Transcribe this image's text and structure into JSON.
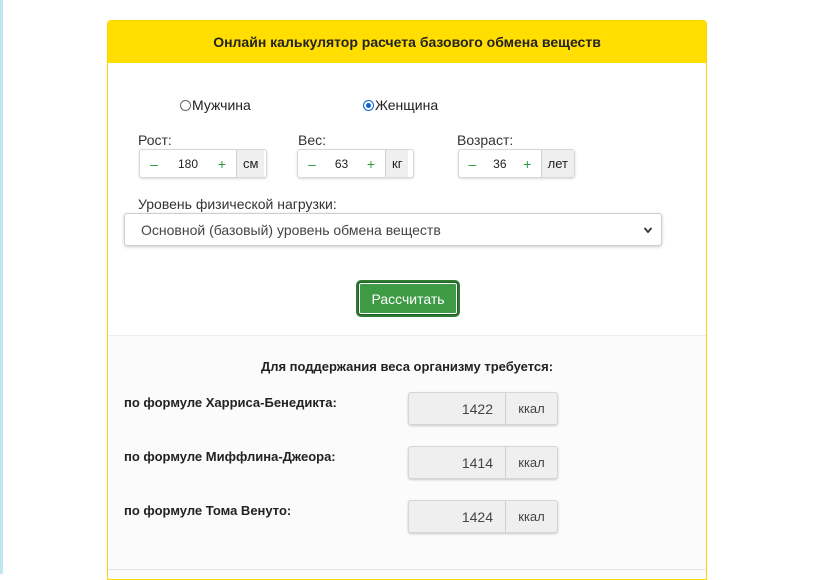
{
  "header": {
    "title": "Онлайн калькулятор расчета базового обмена веществ"
  },
  "gender": {
    "options": [
      {
        "label": "Мужчина",
        "checked": false
      },
      {
        "label": "Женщина",
        "checked": true
      }
    ]
  },
  "fields": {
    "height": {
      "label": "Рост:",
      "value": "180",
      "unit": "см",
      "minus": "–",
      "plus": "+"
    },
    "weight": {
      "label": "Вес:",
      "value": "63",
      "unit": "кг",
      "minus": "–",
      "plus": "+"
    },
    "age": {
      "label": "Возраст:",
      "value": "36",
      "unit": "лет",
      "minus": "–",
      "plus": "+"
    }
  },
  "activity": {
    "label": "Уровень физической нагрузки:",
    "selected": "Основной (базовый) уровень обмена веществ"
  },
  "calculate_button": "Рассчитать",
  "results": {
    "title": "Для поддержания веса организму требуется:",
    "items": [
      {
        "label": "по формуле Харриса-Бенедикта:",
        "value": "1422",
        "unit": "ккал"
      },
      {
        "label": "по формуле Миффлина-Джеора:",
        "value": "1414",
        "unit": "ккал"
      },
      {
        "label": "по формуле Тома Венуто:",
        "value": "1424",
        "unit": "ккал"
      }
    ]
  },
  "colors": {
    "header_bg": "#ffde00",
    "button_green": "#3e9a45",
    "radio_blue": "#0a66d6"
  }
}
